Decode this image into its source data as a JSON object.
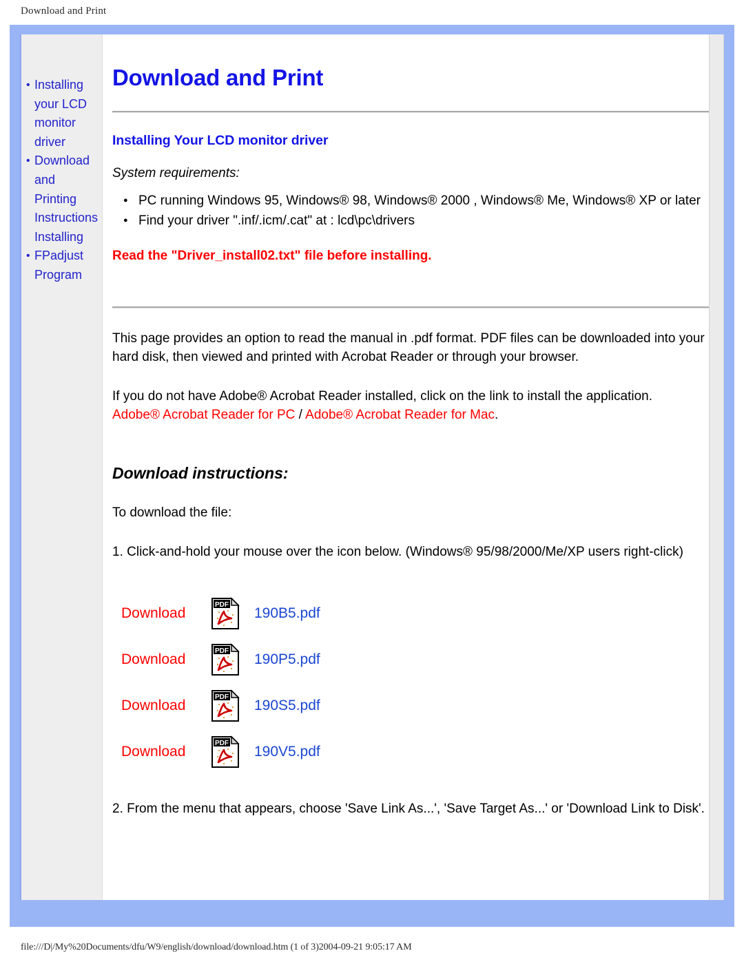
{
  "print_header": "Download and Print",
  "print_footer": "file:///D|/My%20Documents/dfu/W9/english/download/download.htm (1 of 3)2004-09-21 9:05:17 AM",
  "colors": {
    "frame_blue": "#9ab5f5",
    "heading_blue": "#1414e6",
    "link_red": "#ff0000",
    "file_blue": "#1a46d2",
    "sidebar_gray": "#eeeeee"
  },
  "sidebar": {
    "items": [
      {
        "label": "Installing your LCD monitor driver"
      },
      {
        "label": "Download and Printing Instructions Installing"
      },
      {
        "label": "FPadjust Program"
      }
    ]
  },
  "main": {
    "page_title": "Download and Print",
    "section_title": "Installing Your LCD monitor driver",
    "system_requirements_label": "System requirements:",
    "requirements": [
      "PC running Windows 95, Windows® 98, Windows® 2000 , Windows® Me, Windows® XP or later",
      "Find your driver \".inf/.icm/.cat\" at : lcd\\pc\\drivers"
    ],
    "warning": "Read the \"Driver_install02.txt\" file before installing.",
    "intro_paragraph": "This page provides an option to read the manual in .pdf format. PDF files can be downloaded into your hard disk, then viewed and printed with Acrobat Reader or through your browser.",
    "acrobat_paragraph": "If you do not have Adobe® Acrobat Reader installed, click on the link to install the application.",
    "acrobat_link_pc": "Adobe® Acrobat Reader for PC",
    "acrobat_link_separator": " / ",
    "acrobat_link_mac": "Adobe® Acrobat Reader for Mac",
    "acrobat_link_period": ".",
    "download_instructions_heading": "Download instructions:",
    "to_download_label": "To download the file:",
    "step_1": "1. Click-and-hold your mouse over the icon below. (Windows® 95/98/2000/Me/XP users right-click)",
    "step_2": "2. From the menu that appears, choose 'Save Link As...', 'Save Target As...' or 'Download Link to Disk'.",
    "downloads": [
      {
        "action": "Download",
        "icon": "pdf-file-icon",
        "file": "190B5.pdf"
      },
      {
        "action": "Download",
        "icon": "pdf-file-icon",
        "file": "190P5.pdf"
      },
      {
        "action": "Download",
        "icon": "pdf-file-icon",
        "file": "190S5.pdf"
      },
      {
        "action": "Download",
        "icon": "pdf-file-icon",
        "file": "190V5.pdf"
      }
    ]
  }
}
